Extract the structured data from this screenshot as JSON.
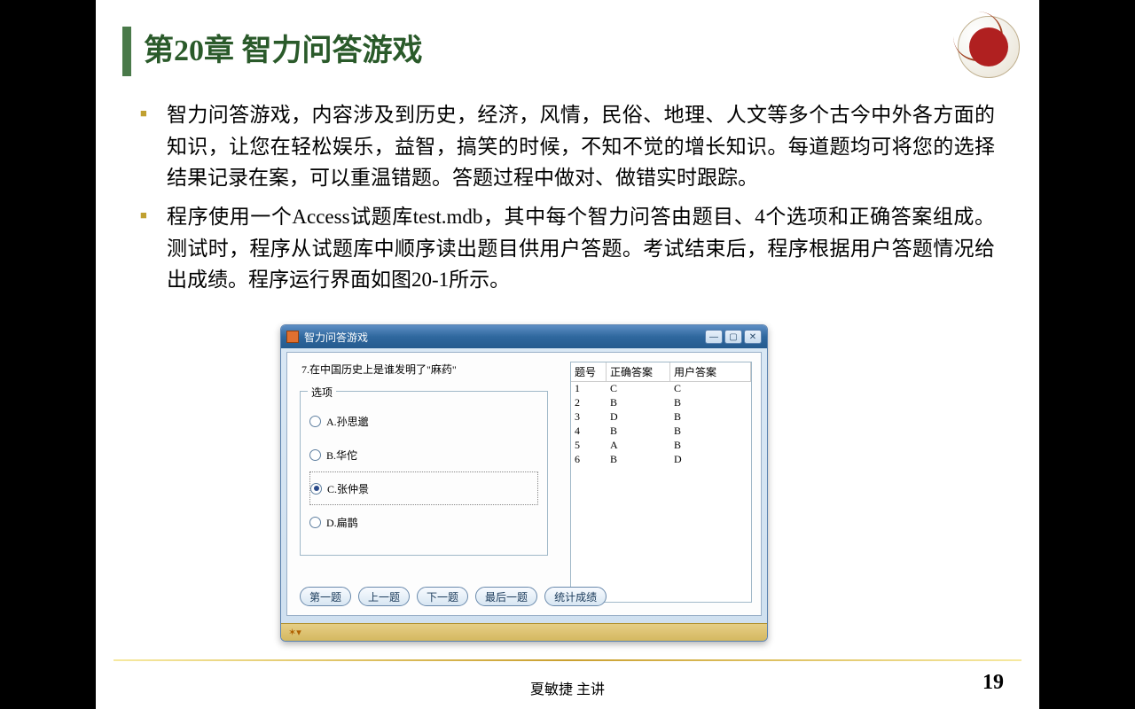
{
  "title": "第20章 智力问答游戏",
  "bullets": [
    "智力问答游戏，内容涉及到历史，经济，风情，民俗、地理、人文等多个古今中外各方面的知识，让您在轻松娱乐，益智，搞笑的时候，不知不觉的增长知识。每道题均可将您的选择结果记录在案，可以重温错题。答题过程中做对、做错实时跟踪。",
    "程序使用一个Access试题库test.mdb，其中每个智力问答由题目、4个选项和正确答案组成。测试时，程序从试题库中顺序读出题目供用户答题。考试结束后，程序根据用户答题情况给出成绩。程序运行界面如图20-1所示。"
  ],
  "app": {
    "window_title": "智力问答游戏",
    "question": "7.在中国历史上是谁发明了\"麻药\"",
    "options_label": "选项",
    "options": [
      {
        "label": "A.孙思邈",
        "checked": false
      },
      {
        "label": "B.华佗",
        "checked": false
      },
      {
        "label": "C.张仲景",
        "checked": true
      },
      {
        "label": "D.扁鹊",
        "checked": false
      }
    ],
    "answer_headers": {
      "no": "题号",
      "correct": "正确答案",
      "user": "用户答案"
    },
    "answers": [
      {
        "no": "1",
        "correct": "C",
        "user": "C"
      },
      {
        "no": "2",
        "correct": "B",
        "user": "B"
      },
      {
        "no": "3",
        "correct": "D",
        "user": "B"
      },
      {
        "no": "4",
        "correct": "B",
        "user": "B"
      },
      {
        "no": "5",
        "correct": "A",
        "user": "B"
      },
      {
        "no": "6",
        "correct": "B",
        "user": "D"
      }
    ],
    "buttons": [
      "第一题",
      "上一题",
      "下一题",
      "最后一题",
      "统计成绩"
    ]
  },
  "footer": "夏敏捷 主讲",
  "page_number": "19"
}
